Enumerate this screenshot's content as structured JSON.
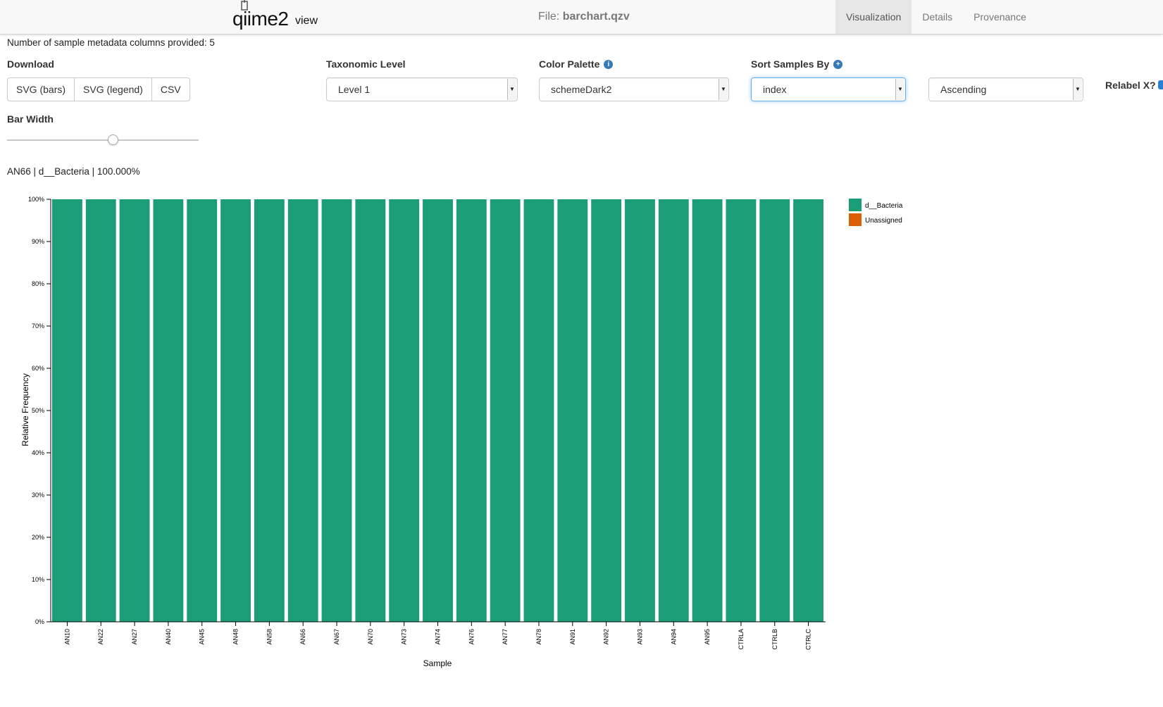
{
  "nav": {
    "logo_main": "qiime2",
    "logo_sub": "view",
    "file_prefix": "File:",
    "file_name": "barchart.qzv",
    "tabs": [
      {
        "label": "Visualization",
        "active": true
      },
      {
        "label": "Details",
        "active": false
      },
      {
        "label": "Provenance",
        "active": false
      }
    ]
  },
  "controls": {
    "metadata_count_text": "Number of sample metadata columns provided: 5",
    "download_label": "Download",
    "download_buttons": [
      "SVG (bars)",
      "SVG (legend)",
      "CSV"
    ],
    "taxonomic_level_label": "Taxonomic Level",
    "taxonomic_level_value": "Level 1",
    "color_palette_label": "Color Palette",
    "color_palette_value": "schemeDark2",
    "sort_samples_label": "Sort Samples By",
    "sort_samples_value": "index",
    "sort_order_value": "Ascending",
    "relabel_label": "Relabel X?",
    "relabel_checked": true,
    "bar_width_label": "Bar Width",
    "bar_width_level": 0.55
  },
  "hover_info": "AN66 | d__Bacteria | 100.000%",
  "colors": {
    "d__Bacteria": "#1b9e77",
    "Unassigned": "#d95f02",
    "accent": "#337ab7"
  },
  "chart_data": {
    "type": "bar",
    "stacked": true,
    "xlabel": "Sample",
    "ylabel": "Relative Frequency",
    "ylim": [
      0,
      100
    ],
    "yticks": [
      "0%",
      "10%",
      "20%",
      "30%",
      "40%",
      "50%",
      "60%",
      "70%",
      "80%",
      "90%",
      "100%"
    ],
    "categories": [
      "AN10",
      "AN22",
      "AN27",
      "AN40",
      "AN45",
      "AN48",
      "AN58",
      "AN66",
      "AN67",
      "AN70",
      "AN73",
      "AN74",
      "AN76",
      "AN77",
      "AN78",
      "AN91",
      "AN92",
      "AN93",
      "AN94",
      "AN95",
      "CTRLA",
      "CTRLB",
      "CTRLC"
    ],
    "series": [
      {
        "name": "d__Bacteria",
        "values": [
          100,
          100,
          100,
          100,
          100,
          100,
          100,
          100,
          100,
          100,
          100,
          100,
          100,
          100,
          100,
          100,
          100,
          100,
          100,
          100,
          100,
          100,
          100
        ]
      },
      {
        "name": "Unassigned",
        "values": [
          0,
          0,
          0,
          0,
          0,
          0,
          0,
          0,
          0,
          0,
          0,
          0,
          0,
          0,
          0,
          0,
          0,
          0,
          0,
          0,
          0,
          0,
          0
        ]
      }
    ],
    "legend_position": "right"
  }
}
